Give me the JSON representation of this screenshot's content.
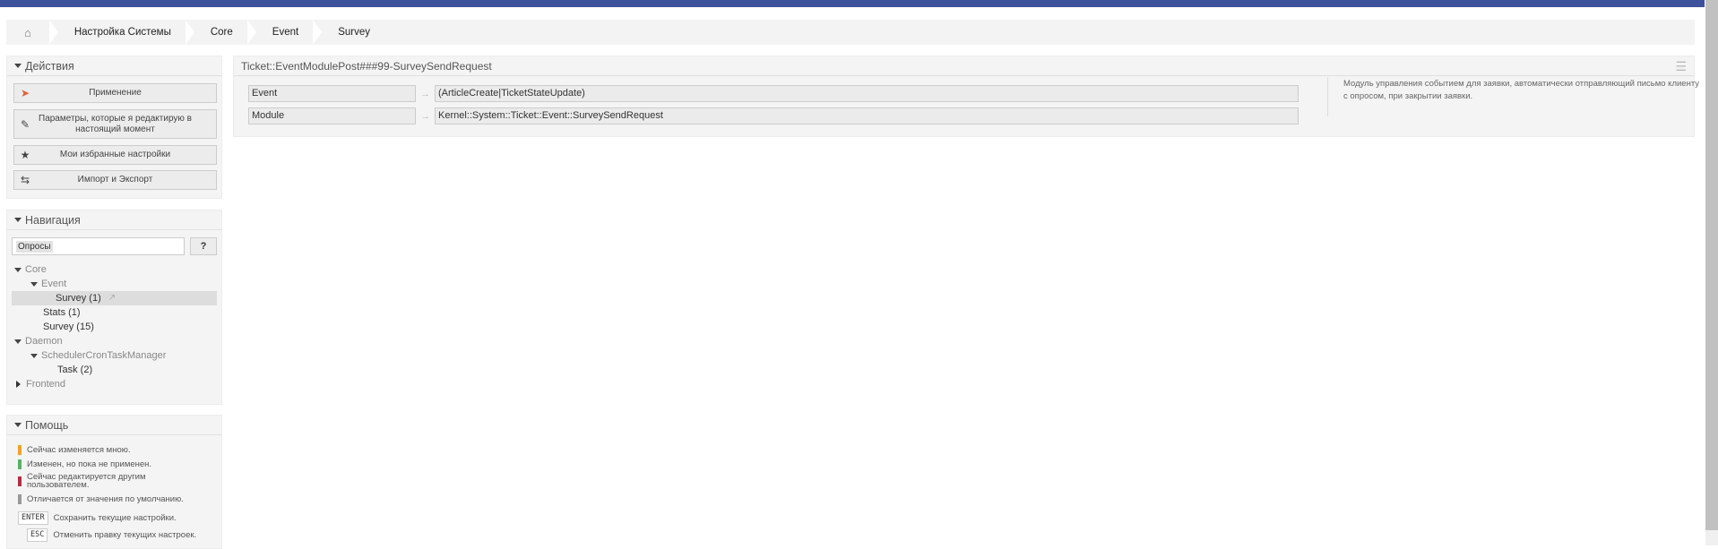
{
  "breadcrumb": {
    "home_icon": "home-icon",
    "items": [
      "Настройка Системы",
      "Core",
      "Event",
      "Survey"
    ]
  },
  "actions": {
    "title": "Действия",
    "buttons": [
      {
        "icon": "rocket-icon",
        "label": "Применение"
      },
      {
        "icon": "edit-icon",
        "label": "Параметры, которые я редактирую в настоящий момент"
      },
      {
        "icon": "star-icon",
        "label": "Мои избранные настройки"
      },
      {
        "icon": "exchange-icon",
        "label": "Импорт и Экспорт"
      }
    ]
  },
  "navigation": {
    "title": "Навигация",
    "search_value": "Опросы",
    "help_button": "?",
    "tree": [
      {
        "label": "Core",
        "level": 0,
        "expanded": true,
        "type": "group"
      },
      {
        "label": "Event",
        "level": 1,
        "expanded": true,
        "type": "group"
      },
      {
        "label": "Survey (1)",
        "level": 2,
        "selected": true,
        "type": "leaf"
      },
      {
        "label": "Stats (1)",
        "level": 1,
        "type": "leaf"
      },
      {
        "label": "Survey (15)",
        "level": 1,
        "type": "leaf"
      },
      {
        "label": "Daemon",
        "level": 0,
        "expanded": true,
        "type": "group"
      },
      {
        "label": "SchedulerCronTaskManager",
        "level": 1,
        "expanded": true,
        "type": "group"
      },
      {
        "label": "Task (2)",
        "level": 2,
        "type": "leaf"
      },
      {
        "label": "Frontend",
        "level": 0,
        "expanded": false,
        "type": "group"
      }
    ]
  },
  "help": {
    "title": "Помощь",
    "legend": [
      {
        "color": "#f0a030",
        "label": "Сейчас изменяется мною."
      },
      {
        "color": "#5cb060",
        "label": "Изменен, но пока не применен."
      },
      {
        "color": "#b03040",
        "label": "Сейчас редактируется другим пользователем."
      },
      {
        "color": "#999999",
        "label": "Отличается от значения по умолчанию."
      }
    ],
    "keys": [
      {
        "key": "ENTER",
        "label": "Сохранить текущие настройки."
      },
      {
        "key": "ESC",
        "label": "Отменить правку текущих настроек."
      }
    ]
  },
  "setting": {
    "title": "Ticket::EventModulePost###99-SurveySendRequest",
    "fields": [
      {
        "key": "Event",
        "value": "(ArticleCreate|TicketStateUpdate)"
      },
      {
        "key": "Module",
        "value": "Kernel::System::Ticket::Event::SurveySendRequest"
      }
    ],
    "description": "Модуль управления событием для заявки, автоматически отправляющий письмо клиенту с опросом, при закрытии заявки."
  },
  "colors": {
    "topbar": "#3e529c"
  }
}
